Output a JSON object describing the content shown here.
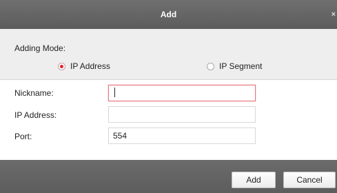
{
  "dialog": {
    "title": "Add",
    "close_glyph": "×"
  },
  "adding_mode": {
    "label": "Adding Mode:",
    "options": [
      {
        "label": "IP Address",
        "checked": true
      },
      {
        "label": "IP Segment",
        "checked": false
      }
    ]
  },
  "form": {
    "nickname": {
      "label": "Nickname:",
      "value": ""
    },
    "ip_address": {
      "label": "IP Address:",
      "value": ""
    },
    "port": {
      "label": "Port:",
      "value": "554"
    }
  },
  "buttons": {
    "add": "Add",
    "cancel": "Cancel"
  },
  "colors": {
    "accent_red": "#e0212b",
    "titlebar": "#666666",
    "panel": "#eeeeee"
  }
}
